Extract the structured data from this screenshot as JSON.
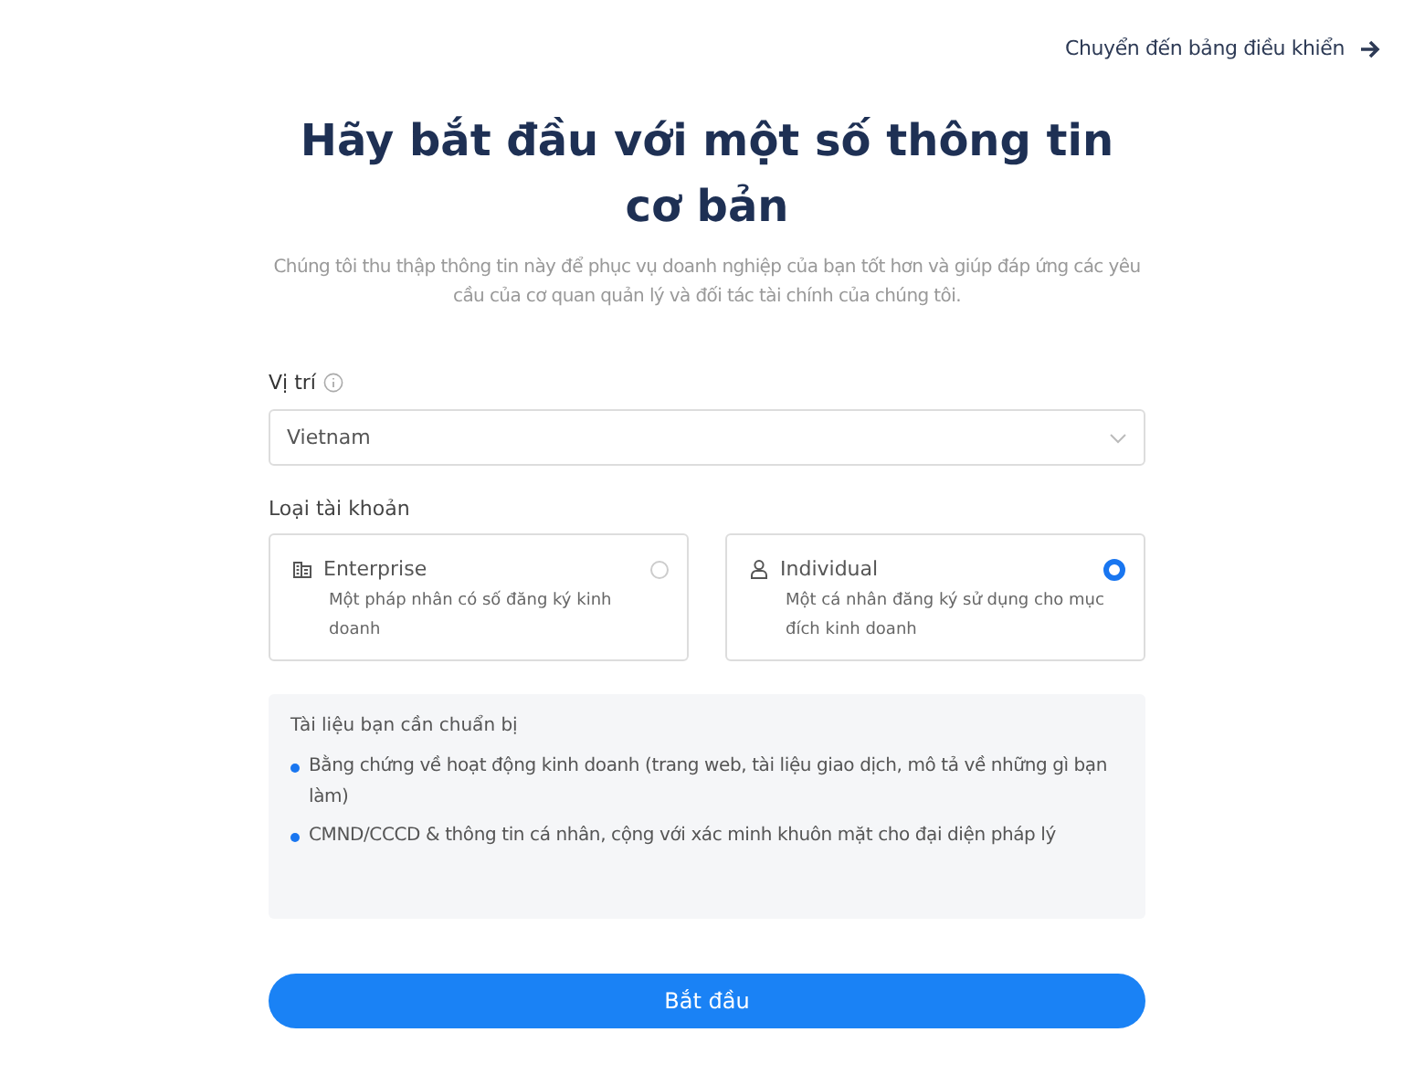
{
  "dashboard_link": {
    "label": "Chuyển đến bảng điều khiển"
  },
  "title": "Hãy bắt đầu với một số thông tin cơ bản",
  "subtitle": "Chúng tôi thu thập thông tin này để phục vụ doanh nghiệp của bạn tốt hơn và giúp đáp ứng các yêu cầu của cơ quan quản lý và đối tác tài chính của chúng tôi.",
  "location": {
    "label": "Vị trí",
    "value": "Vietnam"
  },
  "account_type": {
    "label": "Loại tài khoản",
    "options": [
      {
        "kind": "building",
        "title": "Enterprise",
        "description": "Một pháp nhân có số đăng ký kinh doanh",
        "selected": false
      },
      {
        "kind": "person",
        "title": "Individual",
        "description": "Một cá nhân đăng ký sử dụng cho mục đích kinh doanh",
        "selected": true
      }
    ]
  },
  "documents": {
    "heading": "Tài liệu bạn cần chuẩn bị",
    "items": [
      "Bằng chứng về hoạt động kinh doanh (trang web, tài liệu giao dịch, mô tả về những gì bạn làm)",
      "CMND/CCCD & thông tin cá nhân, cộng với xác minh khuôn mặt cho đại diện pháp lý"
    ]
  },
  "start_button": "Bắt đầu"
}
